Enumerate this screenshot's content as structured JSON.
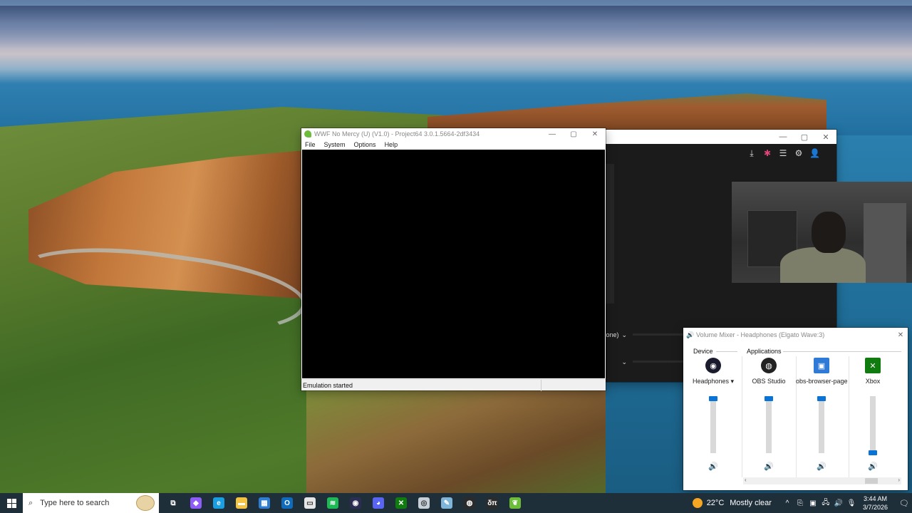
{
  "project64": {
    "title": "WWF No Mercy (U) (V1.0) - Project64 3.0.1.5664-2df3434",
    "menu": [
      "File",
      "System",
      "Options",
      "Help"
    ],
    "status": "Emulation started",
    "controls": {
      "minimize": "—",
      "maximize": "▢",
      "close": "✕"
    }
  },
  "dark_app": {
    "controls": {
      "minimize": "—",
      "maximize": "▢",
      "close": "✕"
    },
    "toolbar_icons": [
      "download-icon",
      "slack-icon",
      "sliders-icon",
      "gear-icon",
      "user-icon"
    ],
    "toolbar_glyphs": [
      "⤓",
      "✱",
      "☰",
      "⚙",
      "👤"
    ],
    "dropdown_1": "one)",
    "dropdown_chevron": "⌄"
  },
  "volume_mixer": {
    "title": "Volume Mixer - Headphones (Elgato Wave:3)",
    "close": "✕",
    "device_label": "Device",
    "applications_label": "Applications",
    "channels": [
      {
        "name": "Headphones ▾",
        "icon": "elgato-icon",
        "volume_pct": 100,
        "kind": "device"
      },
      {
        "name": "OBS Studio",
        "icon": "obs-icon",
        "volume_pct": 100,
        "kind": "app"
      },
      {
        "name": "obs-browser-page",
        "icon": "browser-page-icon",
        "volume_pct": 100,
        "kind": "app"
      },
      {
        "name": "Xbox",
        "icon": "xbox-icon",
        "volume_pct": 0,
        "kind": "app"
      }
    ],
    "speaker_glyph": "🔊",
    "scroll_left": "‹",
    "scroll_right": "›"
  },
  "taskbar": {
    "search_placeholder": "Type here to search",
    "apps": [
      {
        "name": "task-view-icon",
        "glyph": "⧉",
        "color": "#1f2f3a"
      },
      {
        "name": "copilot-icon",
        "glyph": "◆",
        "color": "#8e5cf7"
      },
      {
        "name": "edge-icon",
        "glyph": "e",
        "color": "#1b9de2"
      },
      {
        "name": "file-explorer-icon",
        "glyph": "▬",
        "color": "#f3c443"
      },
      {
        "name": "store-icon",
        "glyph": "▦",
        "color": "#2d7dd2"
      },
      {
        "name": "outlook-icon",
        "glyph": "O",
        "color": "#0f6cbd"
      },
      {
        "name": "document-icon",
        "glyph": "▭",
        "color": "#e6e6e6"
      },
      {
        "name": "spotify-icon",
        "glyph": "≋",
        "color": "#1db954"
      },
      {
        "name": "elgato-wave-icon",
        "glyph": "◉",
        "color": "#2b2d52"
      },
      {
        "name": "discord-icon",
        "glyph": "◕",
        "color": "#5865f2"
      },
      {
        "name": "xbox-icon",
        "glyph": "✕",
        "color": "#107c10"
      },
      {
        "name": "steam-icon",
        "glyph": "◎",
        "color": "#c7d0d8"
      },
      {
        "name": "notes-icon",
        "glyph": "✎",
        "color": "#7fb5d8"
      },
      {
        "name": "obs-icon",
        "glyph": "◍",
        "color": "#2b2b2b"
      },
      {
        "name": "delta-pi-icon",
        "glyph": "δπ",
        "color": "#2b2b2b"
      },
      {
        "name": "project64-icon",
        "glyph": "❦",
        "color": "#6bbd3a"
      }
    ],
    "weather_temp": "22°C",
    "weather_desc": "Mostly clear",
    "tray_icons": [
      "^",
      "⎘",
      "▣",
      "🖧",
      "🔊",
      "🎙"
    ],
    "time": "3:44 AM",
    "date": "3/7/2026",
    "notif_glyph": "🗨"
  }
}
